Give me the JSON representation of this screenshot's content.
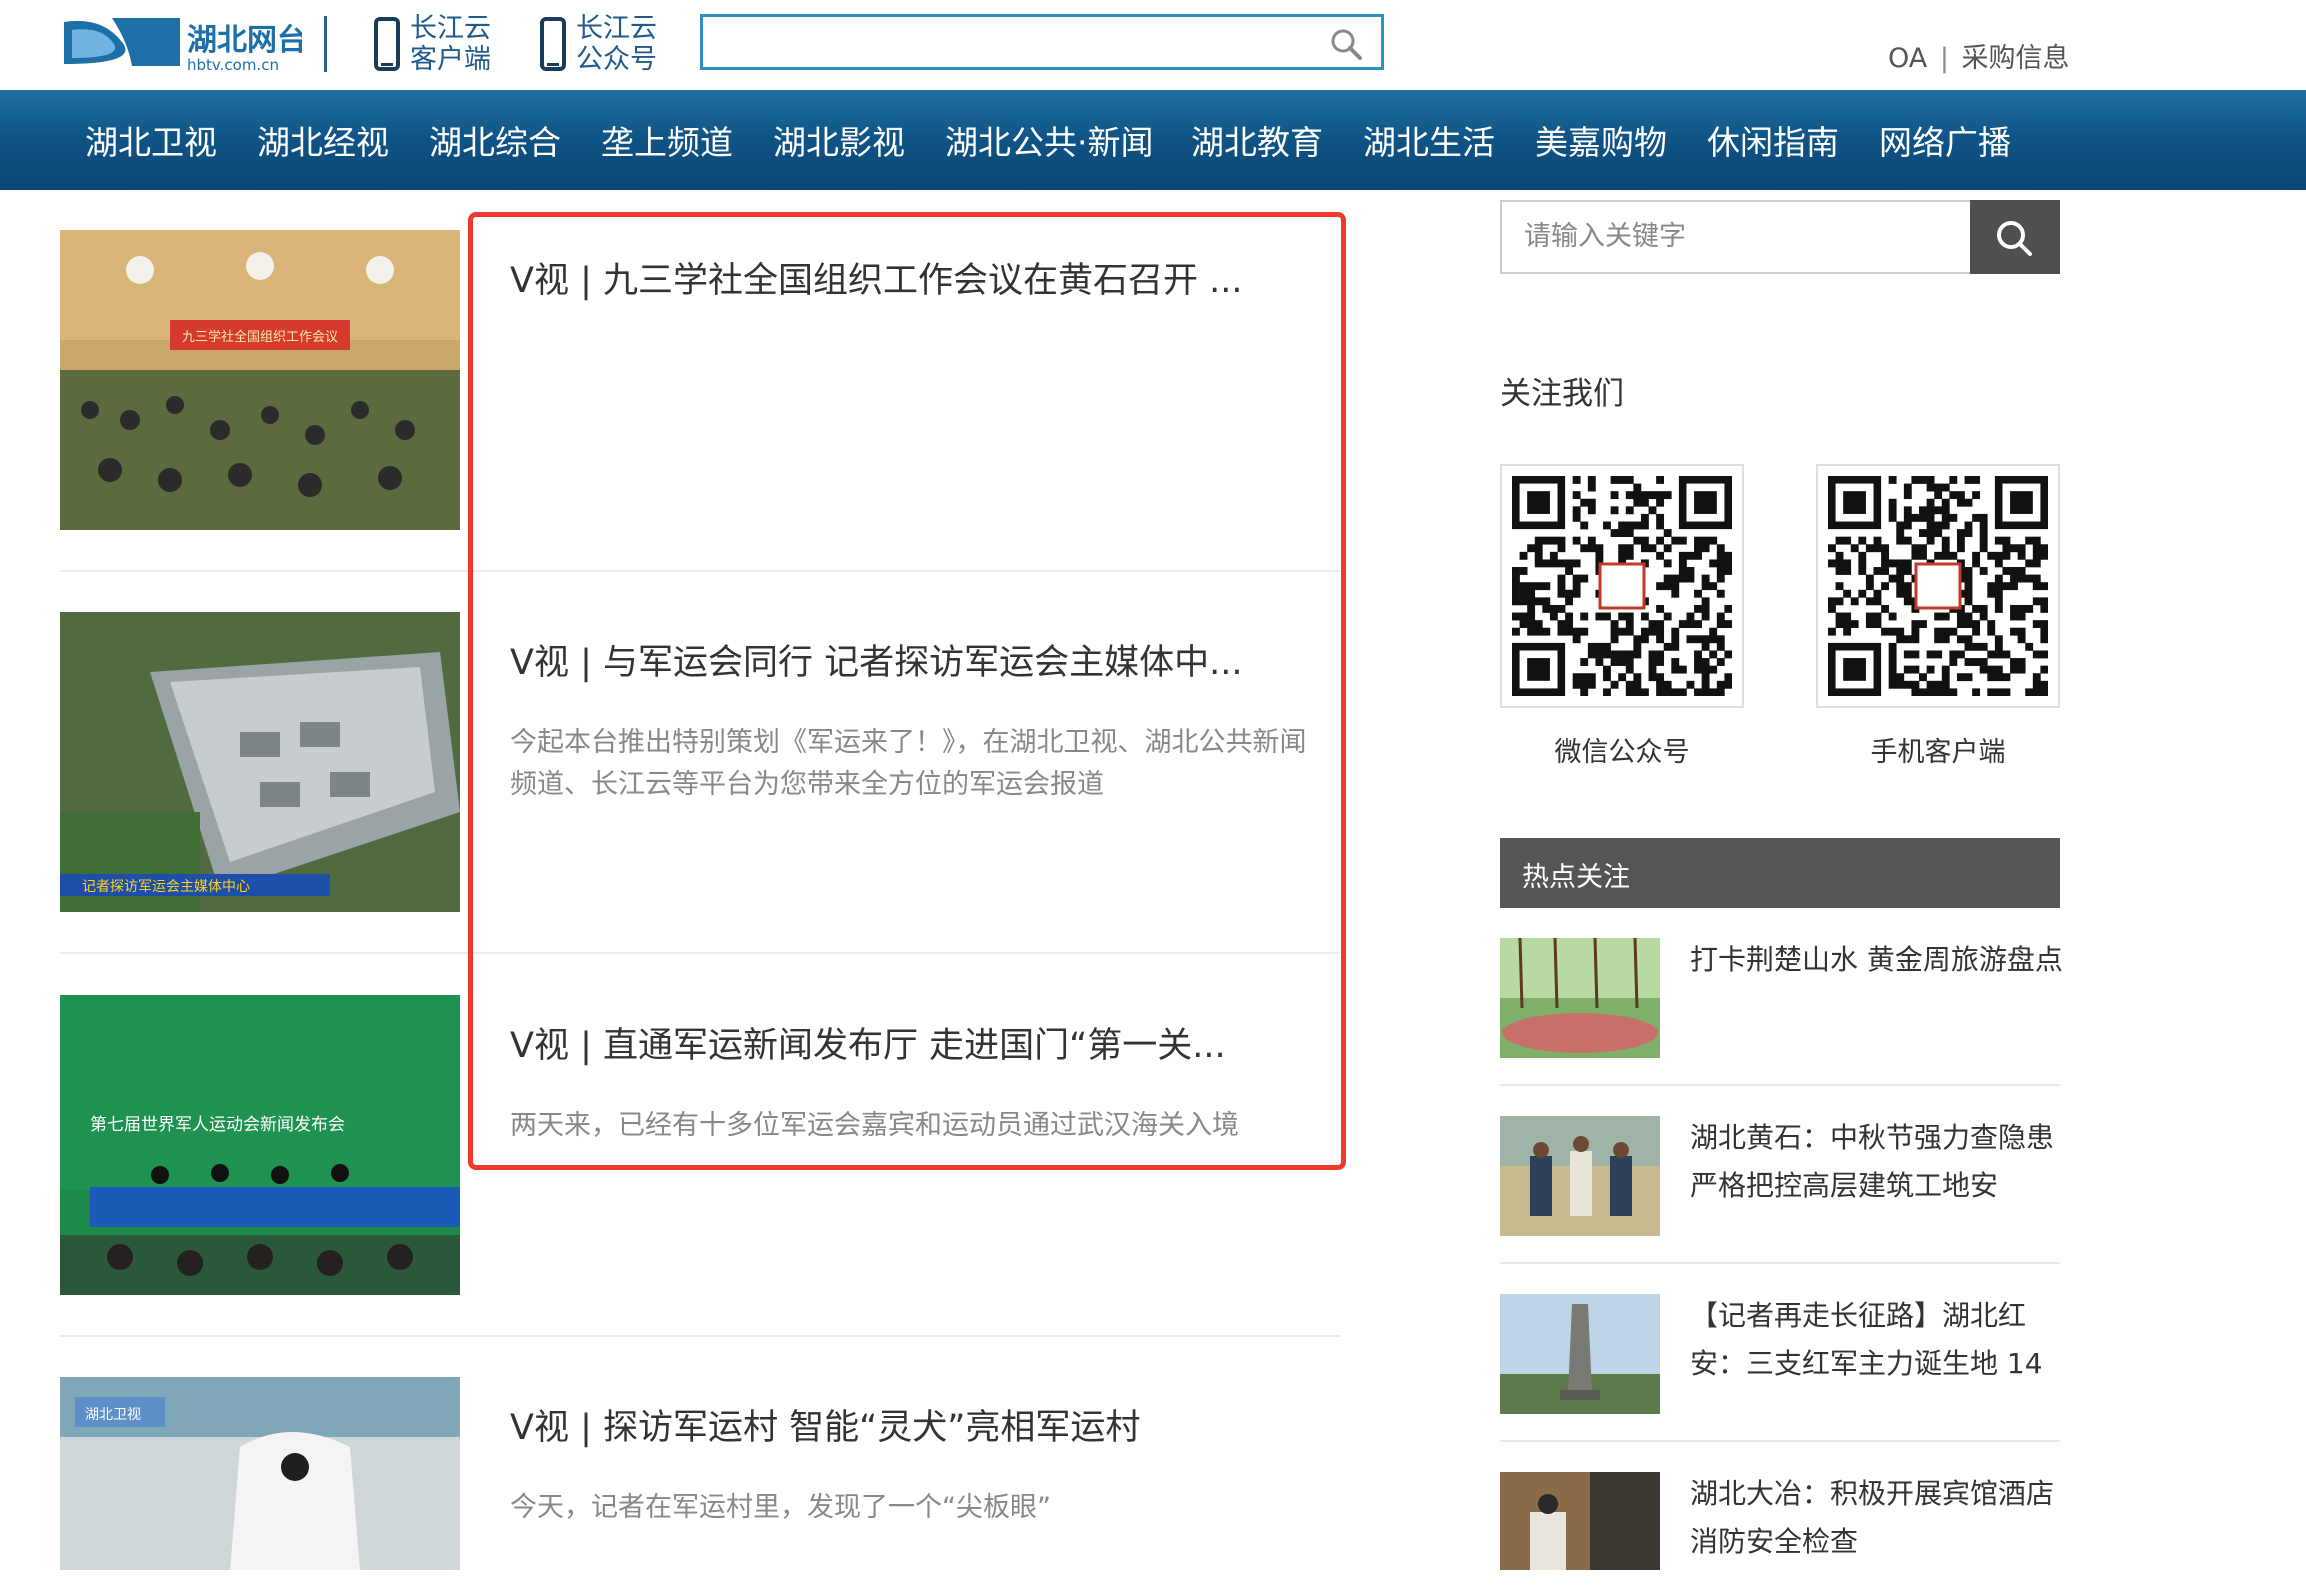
{
  "header": {
    "logo_text": "湖北网台",
    "logo_domain": "hbtv.com.cn",
    "app_links": [
      {
        "label": "长江云\n客户端",
        "icon": "phone-icon"
      },
      {
        "label": "长江云\n公众号",
        "icon": "phone-icon"
      }
    ],
    "search_value": "",
    "oa_link": "OA",
    "separator": "|",
    "purchase_link": "采购信息"
  },
  "nav": {
    "items": [
      "湖北卫视",
      "湖北经视",
      "湖北综合",
      "垄上频道",
      "湖北影视",
      "湖北公共·新闻",
      "湖北教育",
      "湖北生活",
      "美嘉购物",
      "休闲指南",
      "网络广播"
    ]
  },
  "articles": [
    {
      "title": "V视 | 九三学社全国组织工作会议在黄石召开 ...",
      "summary": "",
      "thumb_caption": "九三学社全国组织工作会议"
    },
    {
      "title": "V视 | 与军运会同行 记者探访军运会主媒体中...",
      "summary": "今起本台推出特别策划《军运来了！》，在湖北卫视、湖北公共新闻频道、长江云等平台为您带来全方位的军运会报道",
      "thumb_caption": "记者探访军运会主媒体中心"
    },
    {
      "title": "V视 | 直通军运新闻发布厅 走进国门“第一关...",
      "summary": "两天来，已经有十多位军运会嘉宾和运动员通过武汉海关入境",
      "thumb_caption": "第七届世界军人运动会新闻发布会"
    },
    {
      "title": "V视 | 探访军运村 智能“灵犬”亮相军运村",
      "summary": "今天，记者在军运村里，发现了一个“尖板眼”",
      "thumb_caption": "湖北卫视"
    }
  ],
  "sidebar": {
    "search_placeholder": "请输入关键字",
    "follow_title": "关注我们",
    "qr_codes": [
      {
        "label": "微信公众号"
      },
      {
        "label": "手机客户端"
      }
    ],
    "hot_title": "热点关注",
    "hot_items": [
      {
        "text": "打卡荆楚山水 黄金周旅游盘点"
      },
      {
        "text": "湖北黄石：中秋节强力查隐患　严格把控高层建筑工地安"
      },
      {
        "text": "【记者再走长征路】湖北红安：三支红军主力诞生地 14"
      },
      {
        "text": "湖北大冶：积极开展宾馆酒店消防安全检查"
      }
    ]
  },
  "colors": {
    "nav_bg": "#0f5385",
    "brand_blue": "#215b8b",
    "highlight_red": "#f0392b",
    "sidebar_dark": "#555555"
  }
}
